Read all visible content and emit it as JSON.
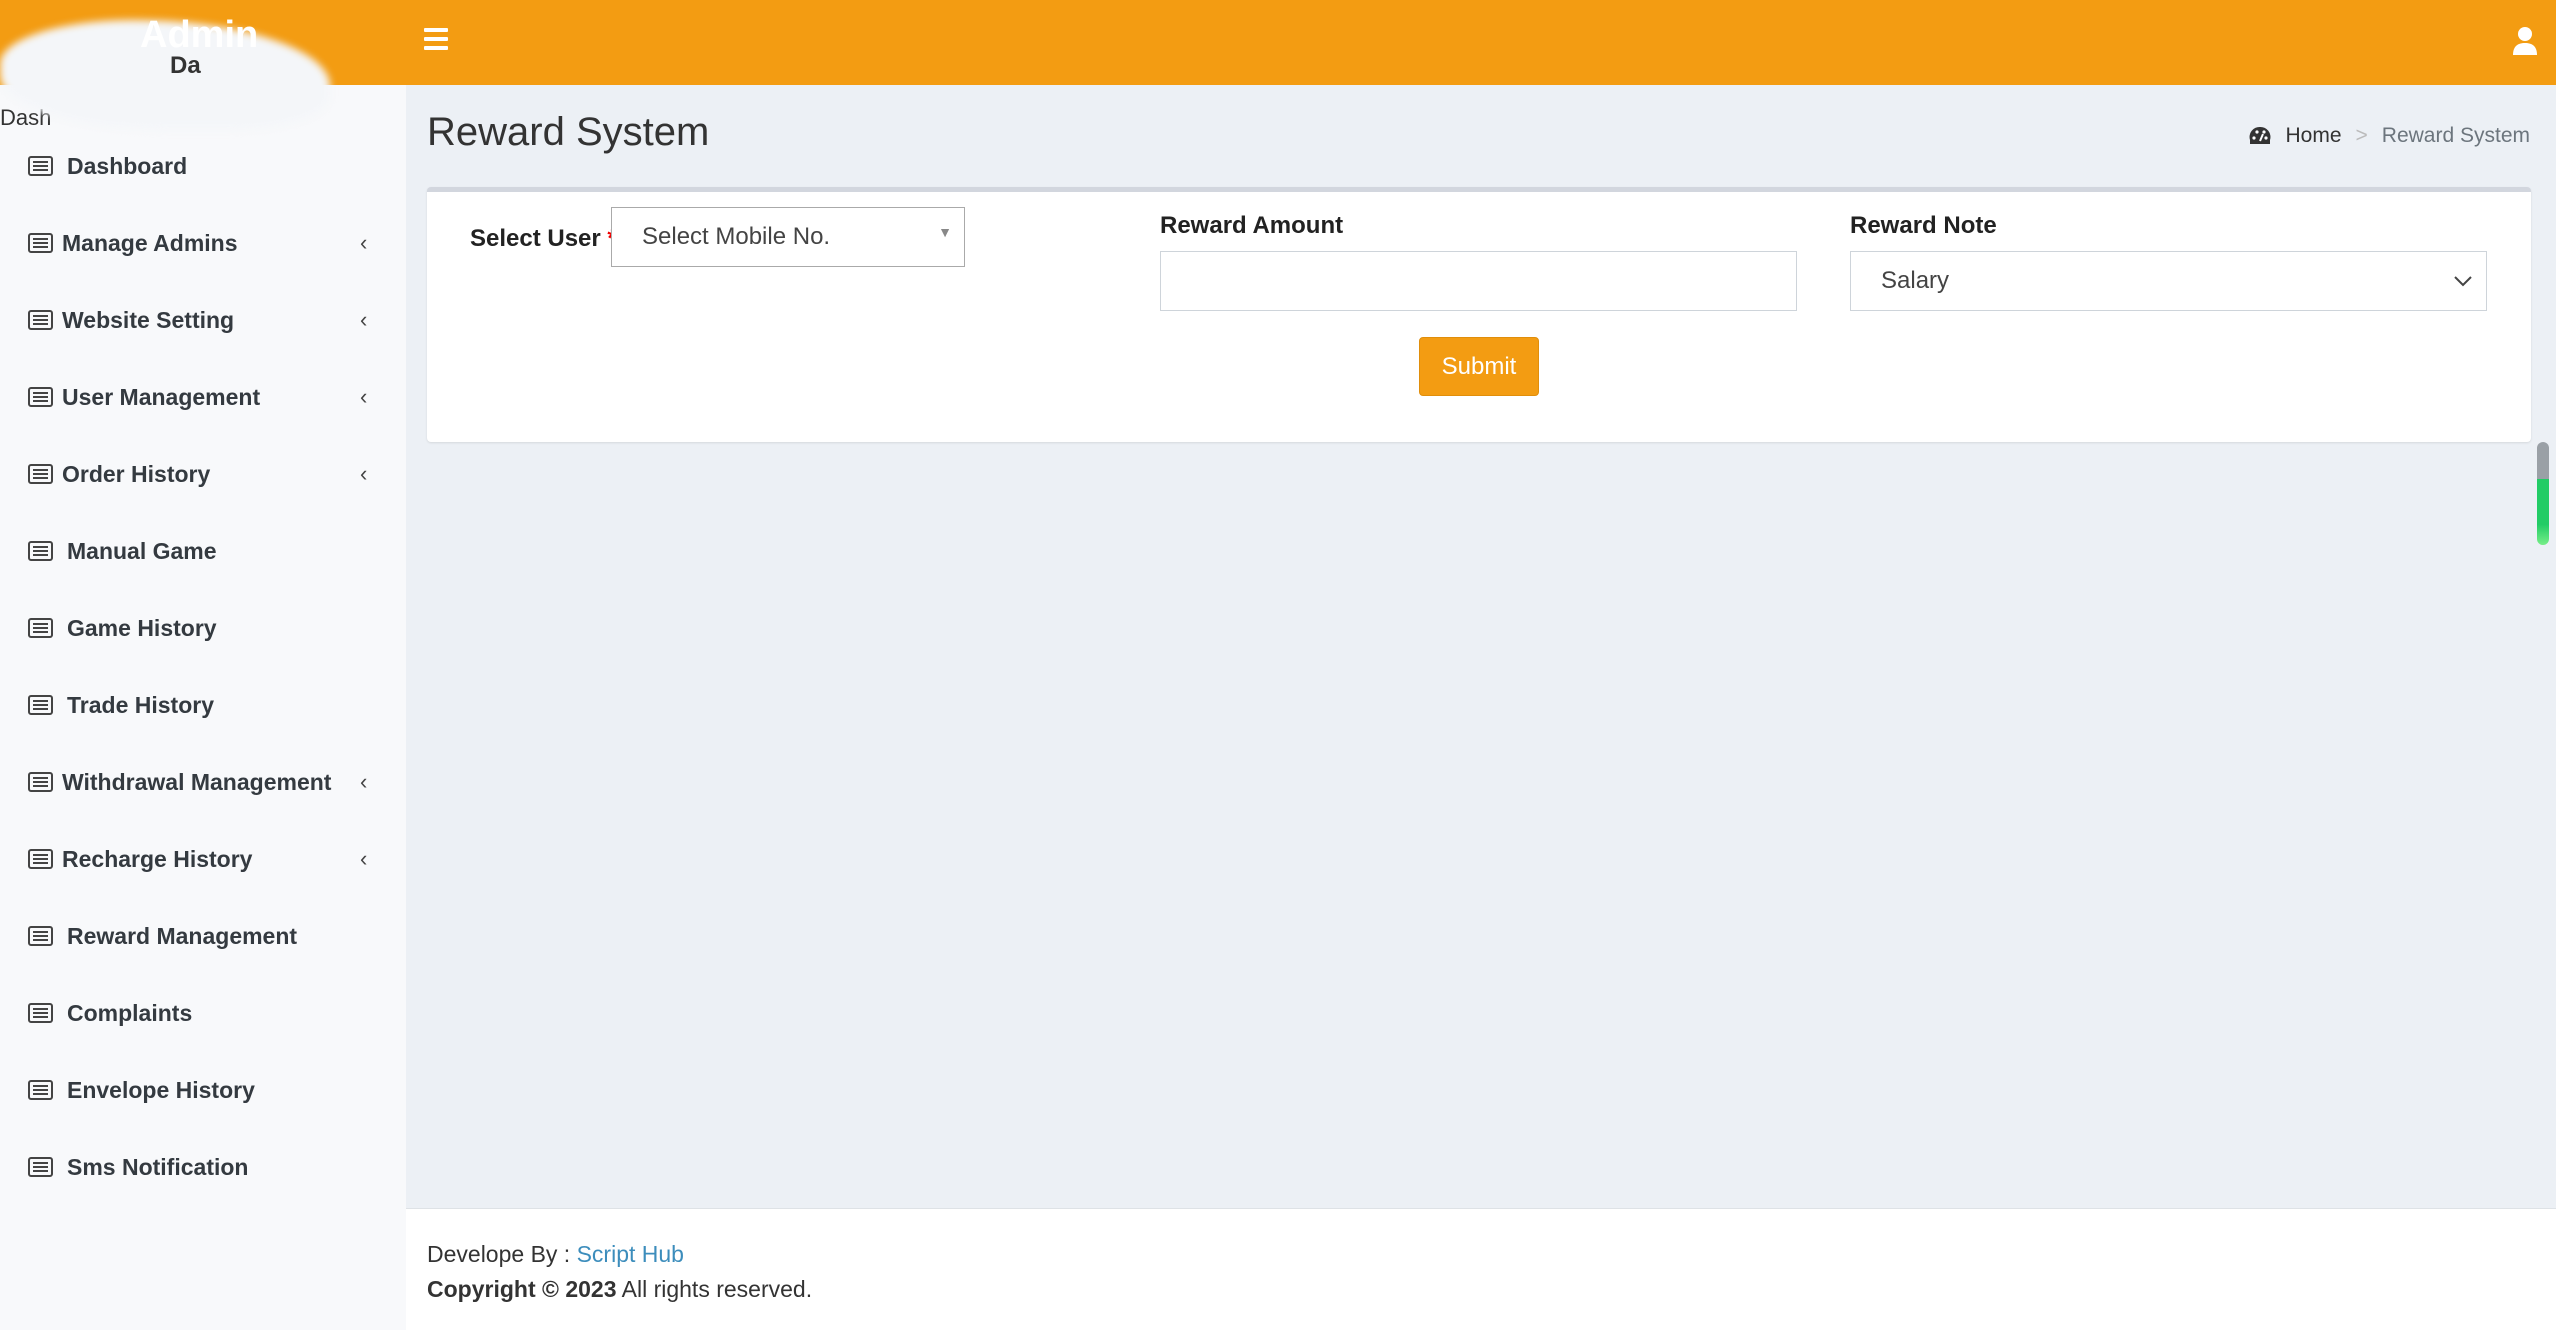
{
  "header": {
    "logo": "Admin",
    "logo_sub": "Da",
    "brand_color": "#f39c12",
    "menu_icon": "hamburger-icon",
    "user_icon": "user-icon"
  },
  "sidebar": {
    "top_text": "Dash",
    "items": [
      {
        "label": "Dashboard",
        "submenu": false
      },
      {
        "label": "Manage Admins",
        "submenu": true
      },
      {
        "label": "Website Setting",
        "submenu": true
      },
      {
        "label": "User Management",
        "submenu": true
      },
      {
        "label": "Order History",
        "submenu": true
      },
      {
        "label": "Manual Game",
        "submenu": false
      },
      {
        "label": "Game History",
        "submenu": false
      },
      {
        "label": "Trade History",
        "submenu": false
      },
      {
        "label": "Withdrawal Management",
        "submenu": true
      },
      {
        "label": "Recharge History",
        "submenu": true
      },
      {
        "label": "Reward Management",
        "submenu": false
      },
      {
        "label": "Complaints",
        "submenu": false
      },
      {
        "label": "Envelope History",
        "submenu": false
      },
      {
        "label": "Sms Notification",
        "submenu": false
      }
    ]
  },
  "page": {
    "title": "Reward System",
    "breadcrumb": {
      "home": "Home",
      "sep": ">",
      "current": "Reward System"
    }
  },
  "form": {
    "select_user_label": "Select User",
    "required_mark": "*",
    "select_user_value": "Select Mobile No.",
    "reward_amount_label": "Reward Amount",
    "reward_amount_value": "",
    "reward_note_label": "Reward Note",
    "reward_note_value": "Salary",
    "submit": "Submit"
  },
  "footer": {
    "develop_by": "Develope By : ",
    "developer": "Script Hub",
    "copyright": "Copyright © 2023",
    "rights": " All rights reserved."
  }
}
